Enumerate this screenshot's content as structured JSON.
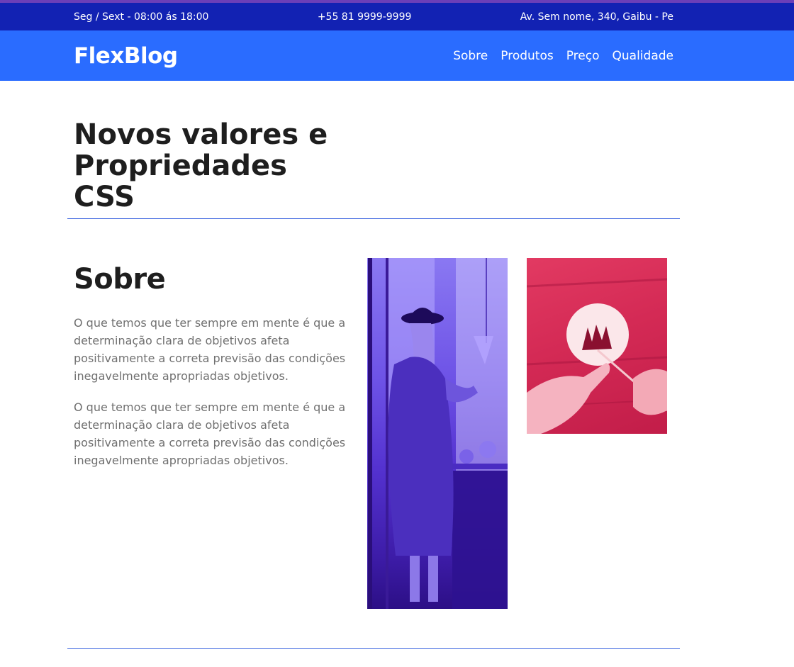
{
  "topbar": {
    "hours": "Seg / Sext - 08:00 ás 18:00",
    "phone": "+55 81 9999-9999",
    "address": "Av. Sem nome, 340, Gaibu - Pe"
  },
  "nav": {
    "logo": "FlexBlog",
    "items": [
      {
        "label": "Sobre"
      },
      {
        "label": "Produtos"
      },
      {
        "label": "Preço"
      },
      {
        "label": "Qualidade"
      }
    ]
  },
  "intro": {
    "title": "Novos valores e Propriedades CSS"
  },
  "about": {
    "heading": "Sobre",
    "paragraphs": [
      "O que temos que ter sempre em mente é que a determinação clara de objetivos afeta positivamente a correta previsão das condições inegavelmente apropriadas objetivos.",
      "O que temos que ter sempre em mente é que a determinação clara de objetivos afeta positivamente a correta previsão das condições inegavelmente apropriadas objetivos."
    ]
  },
  "colors": {
    "topbar": "#1222b3",
    "navbar": "#2a6cff",
    "divider": "#3a64e0",
    "photo_tint_purple": "#5432d0",
    "photo_tint_pink": "#d42a55"
  }
}
